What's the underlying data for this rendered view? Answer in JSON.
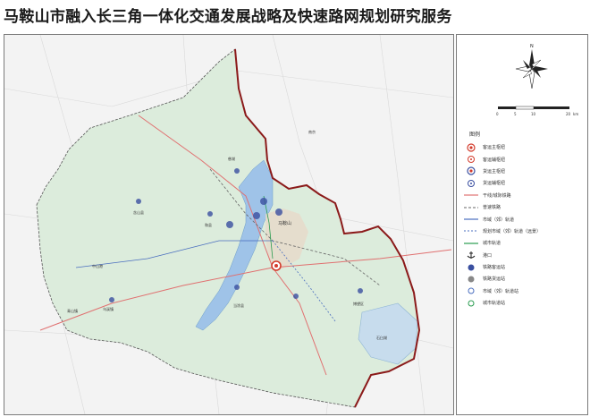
{
  "title": "马鞍山市融入长三角一体化交通发展战略及快速路网规划研究服务",
  "legend": {
    "title": "图例",
    "items": [
      {
        "label": "客运主枢纽",
        "icon": "passenger-main-hub-icon"
      },
      {
        "label": "客运辅枢纽",
        "icon": "passenger-sub-hub-icon"
      },
      {
        "label": "货运主枢纽",
        "icon": "freight-main-hub-icon"
      },
      {
        "label": "货运辅枢纽",
        "icon": "freight-sub-hub-icon"
      },
      {
        "label": "干线/城际铁路",
        "icon": "intercity-railway-icon"
      },
      {
        "label": "普速铁路",
        "icon": "normal-railway-icon"
      },
      {
        "label": "市域（郊）轨道",
        "icon": "suburban-rail-icon"
      },
      {
        "label": "规划市域（郊）轨道（远景）",
        "icon": "planned-suburban-rail-icon"
      },
      {
        "label": "城市轨道",
        "icon": "urban-rail-icon"
      },
      {
        "label": "港口",
        "icon": "port-icon"
      },
      {
        "label": "铁路客运站",
        "icon": "railway-passenger-station-icon"
      },
      {
        "label": "铁路货运站",
        "icon": "railway-freight-station-icon"
      },
      {
        "label": "市域（郊）轨道站",
        "icon": "suburban-rail-station-icon"
      },
      {
        "label": "城市轨道站",
        "icon": "urban-rail-station-icon"
      }
    ]
  },
  "scale": {
    "ticks": [
      "0",
      "5",
      "10",
      "20"
    ],
    "unit": "km"
  },
  "map_labels": {
    "qingshan": "青山镇",
    "zhongshan": "中山港",
    "wuxian": "乌溪镇",
    "bowang": "博望区",
    "dangtu": "当涂县",
    "hexian": "和县",
    "hanshan": "含山县",
    "maanshan": "马鞍山",
    "cihu": "慈湖",
    "shitou": "石臼湖",
    "nanjing": "南京"
  },
  "colors": {
    "boundary": "#8b1a1a",
    "region": "#dfeee0",
    "river": "#9fc3e8",
    "hub": "#d33b2c",
    "station": "#3a4fa0",
    "railway": "#e07070"
  }
}
